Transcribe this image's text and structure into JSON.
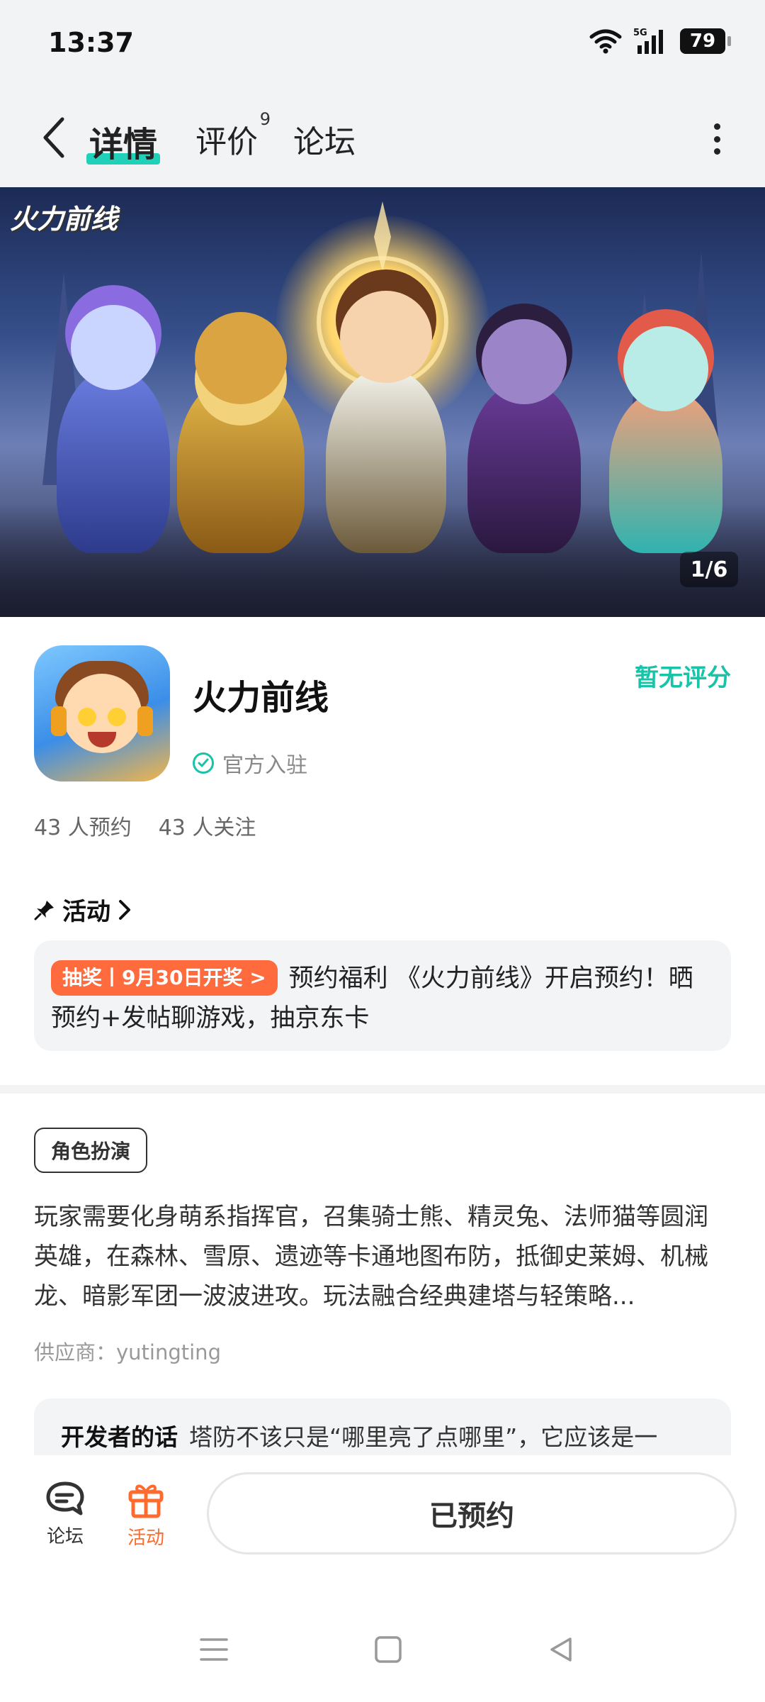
{
  "status_bar": {
    "time": "13:37",
    "network": "5G",
    "battery": "79"
  },
  "nav": {
    "tabs": [
      {
        "label": "详情"
      },
      {
        "label": "评价",
        "badge": "9"
      },
      {
        "label": "论坛"
      }
    ]
  },
  "banner": {
    "logo_text": "火力前线",
    "counter": "1/6"
  },
  "app": {
    "name": "火力前线",
    "rating": "暂无评分",
    "official_label": "官方入驻",
    "reservations": "43 人预约",
    "followers": "43 人关注"
  },
  "activity": {
    "header": "活动",
    "badge": "抽奖丨9月30日开奖 >",
    "text": "预约福利 《火力前线》开启预约！晒预约+发帖聊游戏，抽京东卡"
  },
  "detail": {
    "genre_tag": "角色扮演",
    "description": "玩家需要化身萌系指挥官，召集骑士熊、精灵兔、法师猫等圆润英雄，在森林、雪原、遗迹等卡通地图布防，抵御史莱姆、机械龙、暗影军团一波波进攻。玩法融合经典建塔与轻策略...",
    "supplier": "供应商：yutingting",
    "dev_label": "开发者的话",
    "dev_text": "塔防不该只是“哪里亮了点哪里”，它应该是一"
  },
  "bottom_bar": {
    "forum_label": "论坛",
    "activity_label": "活动",
    "reserve_label": "已预约"
  },
  "colors": {
    "accent_teal": "#19c3a8",
    "accent_orange": "#ff6b3d"
  }
}
